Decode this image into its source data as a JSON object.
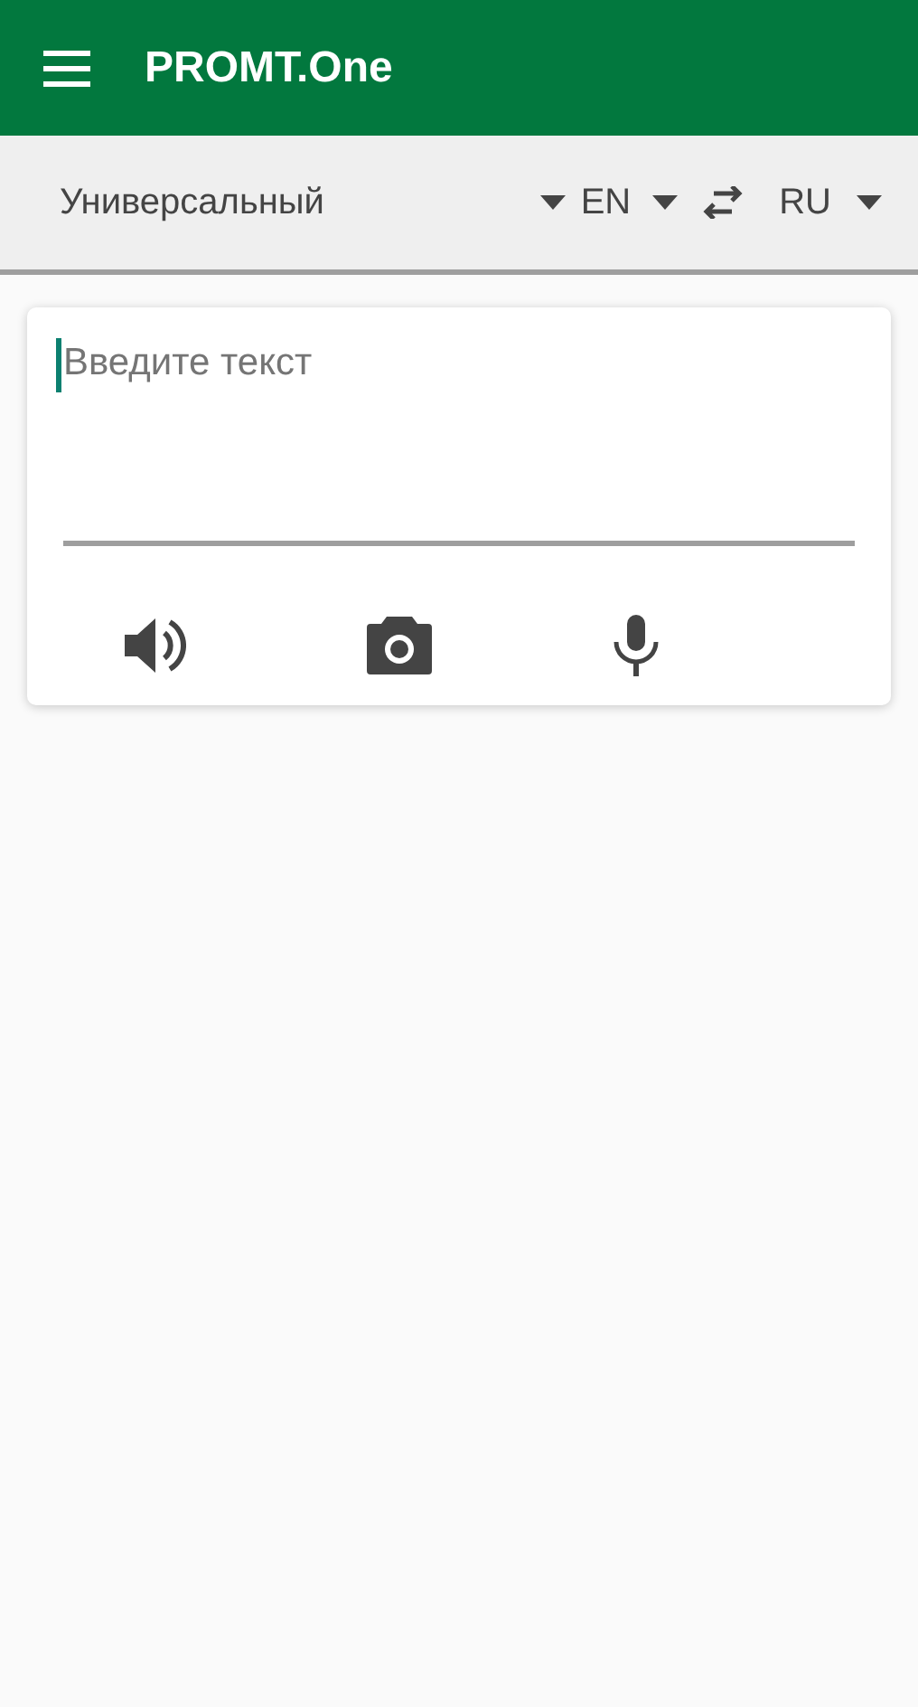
{
  "app_bar": {
    "title": "PROMT.One"
  },
  "language_bar": {
    "domain": "Универсальный",
    "source_language": "EN",
    "target_language": "RU"
  },
  "input": {
    "placeholder": "Введите текст"
  }
}
